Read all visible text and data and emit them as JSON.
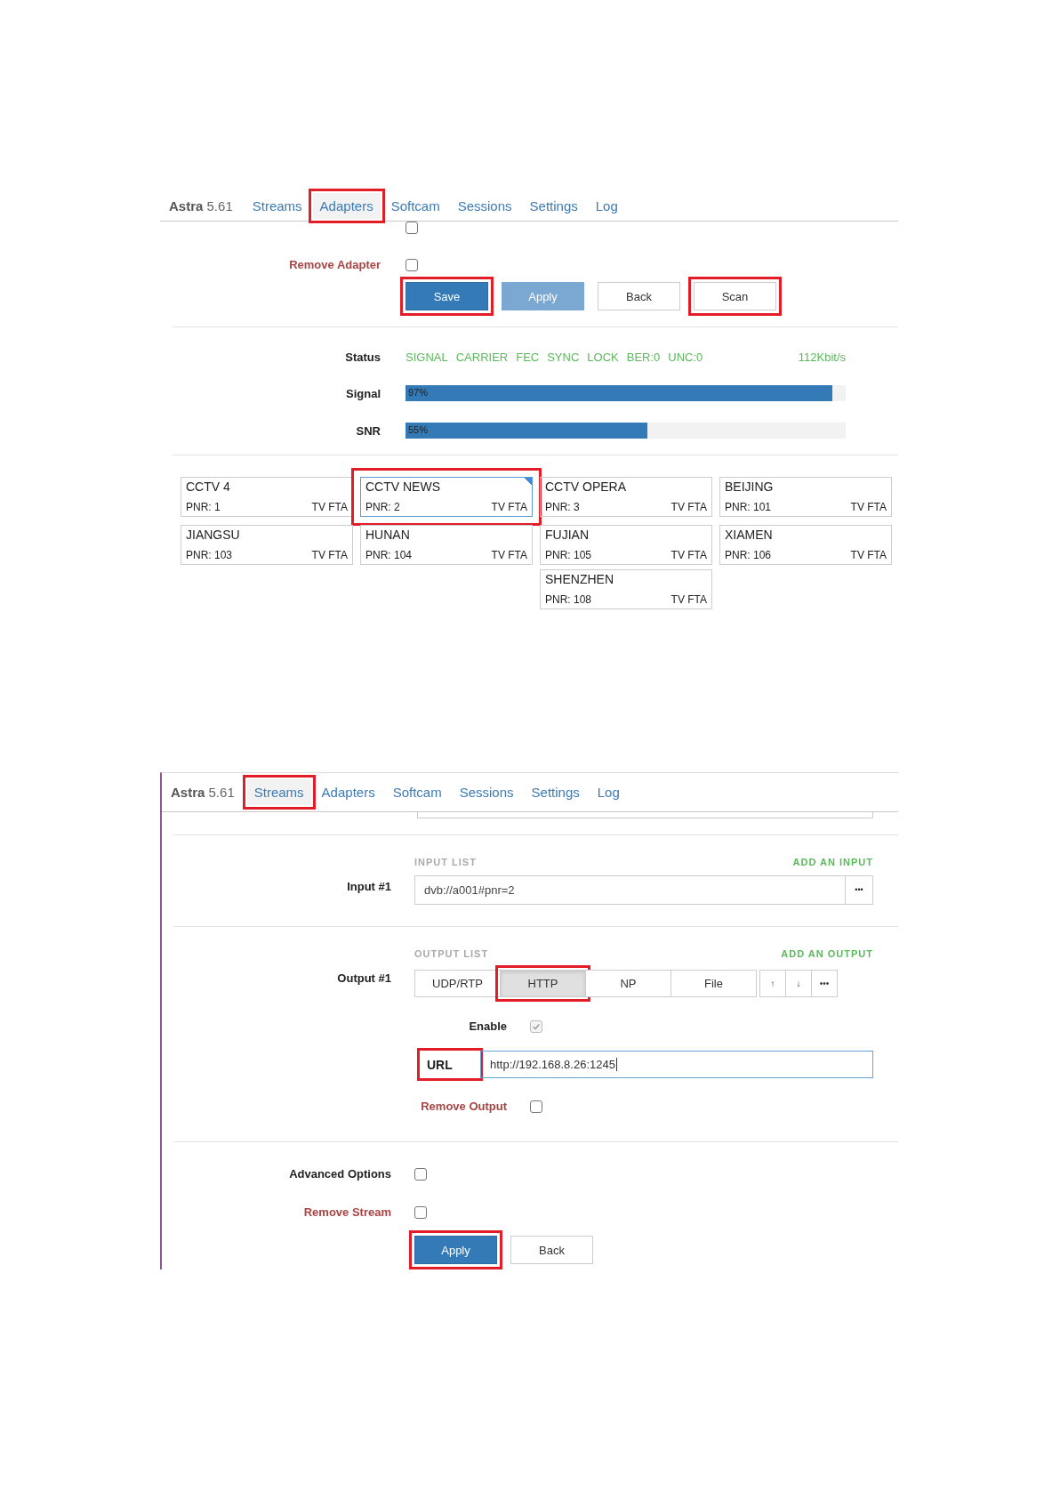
{
  "adapter_screen": {
    "brand": "Astra",
    "version": "5.61",
    "nav": [
      {
        "label": "Streams",
        "selected": false,
        "highlighted": false
      },
      {
        "label": "Adapters",
        "selected": true,
        "highlighted": true
      },
      {
        "label": "Softcam",
        "selected": false,
        "highlighted": false
      },
      {
        "label": "Sessions",
        "selected": false,
        "highlighted": false
      },
      {
        "label": "Settings",
        "selected": false,
        "highlighted": false
      },
      {
        "label": "Log",
        "selected": false,
        "highlighted": false
      }
    ],
    "advanced_checkbox": {
      "checked": false
    },
    "remove_adapter": {
      "label": "Remove Adapter",
      "checked": false
    },
    "buttons": [
      {
        "label": "Save",
        "kind": "primary",
        "highlighted": true
      },
      {
        "label": "Apply",
        "kind": "disabled",
        "highlighted": false
      },
      {
        "label": "Back",
        "kind": "default",
        "highlighted": false
      },
      {
        "label": "Scan",
        "kind": "default",
        "highlighted": true
      }
    ],
    "status": {
      "label": "Status",
      "flags": [
        "SIGNAL",
        "CARRIER",
        "FEC",
        "SYNC",
        "LOCK",
        "BER:0",
        "UNC:0"
      ],
      "bitrate": "112Kbit/s"
    },
    "meters": [
      {
        "label": "Signal",
        "level": 0.97,
        "reading": "97%"
      },
      {
        "label": "SNR",
        "level": 0.55,
        "reading": "55%"
      }
    ],
    "channels": [
      {
        "name": "CCTV 4",
        "pnr": "PNR: 1",
        "type": "TV FTA",
        "selected": false,
        "highlighted": false
      },
      {
        "name": "CCTV NEWS",
        "pnr": "PNR: 2",
        "type": "TV FTA",
        "selected": true,
        "highlighted": true
      },
      {
        "name": "CCTV OPERA",
        "pnr": "PNR: 3",
        "type": "TV FTA",
        "selected": false,
        "highlighted": false
      },
      {
        "name": "BEIJING",
        "pnr": "PNR: 101",
        "type": "TV FTA",
        "selected": false,
        "highlighted": false
      },
      {
        "name": "JIANGSU",
        "pnr": "PNR: 103",
        "type": "TV FTA",
        "selected": false,
        "highlighted": false
      },
      {
        "name": "HUNAN",
        "pnr": "PNR: 104",
        "type": "TV FTA",
        "selected": false,
        "highlighted": false
      },
      {
        "name": "FUJIAN",
        "pnr": "PNR: 105",
        "type": "TV FTA",
        "selected": false,
        "highlighted": false
      },
      {
        "name": "XIAMEN",
        "pnr": "PNR: 106",
        "type": "TV FTA",
        "selected": false,
        "highlighted": false
      },
      {
        "name": "SHENZHEN",
        "pnr": "PNR: 108",
        "type": "TV FTA",
        "selected": false,
        "highlighted": false
      }
    ]
  },
  "stream_screen": {
    "brand": "Astra",
    "version": "5.61",
    "nav": [
      {
        "label": "Streams",
        "selected": true,
        "highlighted": true
      },
      {
        "label": "Adapters",
        "selected": false,
        "highlighted": false
      },
      {
        "label": "Softcam",
        "selected": false,
        "highlighted": false
      },
      {
        "label": "Sessions",
        "selected": false,
        "highlighted": false
      },
      {
        "label": "Settings",
        "selected": false,
        "highlighted": false
      },
      {
        "label": "Log",
        "selected": false,
        "highlighted": false
      }
    ],
    "input_list": {
      "heading": "INPUT LIST",
      "add_link": "ADD AN INPUT"
    },
    "input": {
      "label": "Input #1",
      "value": "dvb://a001#pnr=2",
      "menu": "•••"
    },
    "output_list": {
      "heading": "OUTPUT LIST",
      "add_link": "ADD AN OUTPUT"
    },
    "output": {
      "label": "Output #1",
      "types": [
        {
          "label": "UDP/RTP",
          "selected": false,
          "highlighted": false
        },
        {
          "label": "HTTP",
          "selected": true,
          "highlighted": true
        },
        {
          "label": "NP",
          "selected": false,
          "highlighted": false
        },
        {
          "label": "File",
          "selected": false,
          "highlighted": false
        }
      ],
      "controls": [
        "↑",
        "↓",
        "•••"
      ]
    },
    "enable": {
      "label": "Enable",
      "checked": true,
      "disabled": true
    },
    "url": {
      "label": "URL",
      "value": "http://192.168.8.26:1245",
      "highlighted": true
    },
    "remove_output": {
      "label": "Remove Output",
      "checked": false
    },
    "advanced": {
      "label": "Advanced Options",
      "checked": false
    },
    "remove_stream": {
      "label": "Remove Stream",
      "checked": false
    },
    "buttons": [
      {
        "label": "Apply",
        "kind": "primary",
        "highlighted": true
      },
      {
        "label": "Back",
        "kind": "default",
        "highlighted": false
      }
    ]
  }
}
